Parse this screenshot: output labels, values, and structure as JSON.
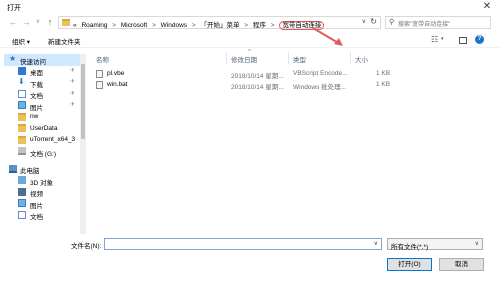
{
  "window": {
    "title": "打开",
    "close_glyph": "✕"
  },
  "address": {
    "overflow": "«",
    "crumbs": [
      "Roaming",
      "Microsoft",
      "Windows",
      "「开始」菜单",
      "程序",
      "宽带自动连接"
    ],
    "separator": ">",
    "dropdown": "∨",
    "refresh": "↻"
  },
  "search": {
    "placeholder": "搜索\"宽带自动连接\"",
    "icon_glyph": "⚲"
  },
  "toolbar": {
    "organize": "组织 ▾",
    "new_folder": "新建文件夹",
    "view_glyph": "☷",
    "view_dd": "▾",
    "help_glyph": "?"
  },
  "sidebar": {
    "items": [
      {
        "label": "快速访问",
        "icon": "star-icon"
      },
      {
        "label": "桌面",
        "icon": "desktop-icon"
      },
      {
        "label": "下载",
        "icon": "download-icon"
      },
      {
        "label": "文档",
        "icon": "document-icon"
      },
      {
        "label": "图片",
        "icon": "picture-icon"
      },
      {
        "label": "nw",
        "icon": "folder-icon"
      },
      {
        "label": "UserData",
        "icon": "folder-icon"
      },
      {
        "label": "uTorrent_x64_3",
        "icon": "folder-icon"
      },
      {
        "label": "文档 (G:)",
        "icon": "drive-icon"
      },
      {
        "label": "此电脑",
        "icon": "computer-icon"
      },
      {
        "label": "3D 对象",
        "icon": "3d-objects-icon"
      },
      {
        "label": "视频",
        "icon": "video-icon"
      },
      {
        "label": "图片",
        "icon": "picture-icon"
      },
      {
        "label": "文档",
        "icon": "document-icon"
      }
    ],
    "pin_glyph": "✈"
  },
  "columns": {
    "name": "名称",
    "modified": "修改日期",
    "type": "类型",
    "size": "大小",
    "sort_caret": "^"
  },
  "files": [
    {
      "name": "pl.vbe",
      "modified": "2018/10/14 星期...",
      "type": "VBScript Encode...",
      "size": "1 KB"
    },
    {
      "name": "win.bat",
      "modified": "2018/10/14 星期...",
      "type": "Windows 批处理...",
      "size": "1 KB"
    }
  ],
  "footer": {
    "filename_label": "文件名(N):",
    "filename_value": "",
    "filetype_value": "所有文件(*.*)",
    "open_button": "打开(O)",
    "cancel_button": "取消",
    "dd_glyph": "∨"
  },
  "colors": {
    "accent": "#0078d7",
    "annotation": "#e15b5b",
    "selection": "#cde8ff"
  }
}
